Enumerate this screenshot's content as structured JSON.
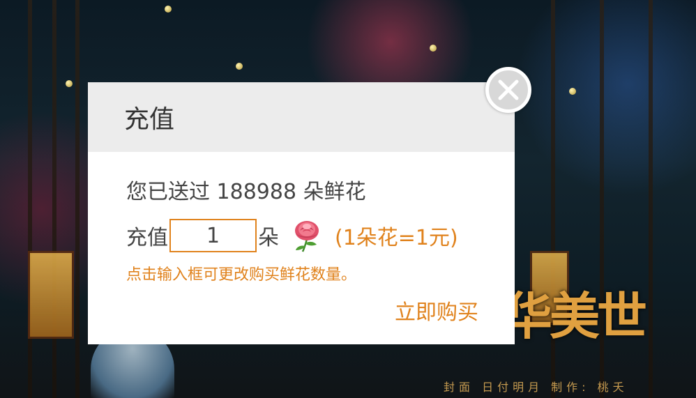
{
  "dialog": {
    "title": "充值",
    "sent_text": "您已送过 188988 朵鲜花",
    "recharge_prefix": "充值",
    "quantity_value": "1",
    "unit": "朵",
    "flower_icon": "rose-icon",
    "price_note": "(1朵花=1元)",
    "hint": "点击输入框可更改购买鲜花数量。",
    "buy_label": "立即购买",
    "close_icon": "close-icon"
  },
  "background": {
    "calligraphy": "华美世",
    "credits": "封面 日付明月 制作: 桃夭"
  },
  "colors": {
    "accent": "#e0821c",
    "header_bg": "#ececec",
    "text": "#444444",
    "close_bg": "#d8d8d8"
  }
}
